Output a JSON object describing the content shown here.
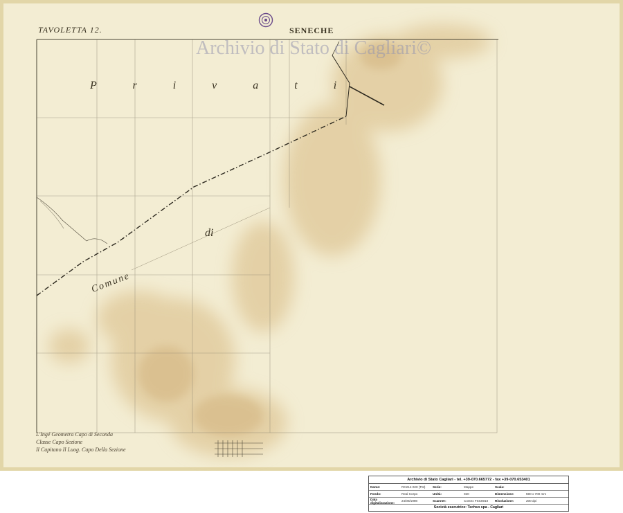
{
  "map": {
    "sheet_label": "TAVOLETTA 12.",
    "locality": "SENECHE",
    "watermark": "Archivio di Stato di Cagliari©",
    "label_privati": "P r i v a t i",
    "label_di": "di",
    "label_comune": "Comune",
    "signature_lines": [
      "L'Ingé Geometra Capo di Seconda",
      "Classe Capo Sezione",
      "Il Capitano Il Luog. Capo Della Sezione"
    ],
    "colors": {
      "paper": "#f2ecd0",
      "stain": "#d9bd85",
      "ink": "#3a3322",
      "watermark": "#9696af"
    }
  },
  "info_table": {
    "title": "Archivio di Stato Cagliari - tel. +39-070.665772 - fax +39-070.653401",
    "rows": [
      [
        {
          "k": "Nome:",
          "v": "RC214-020 (TM)"
        },
        {
          "k": "Serie:",
          "v": "Mappe"
        },
        {
          "k": "Scala:",
          "v": ""
        }
      ],
      [
        {
          "k": "Fondo:",
          "v": "Real Corpo"
        },
        {
          "k": "Unità:",
          "v": "020"
        },
        {
          "k": "Dimensione:",
          "v": "590 x 700 mm"
        }
      ],
      [
        {
          "k": "Data digitalizzazione:",
          "v": "24/09/1998"
        },
        {
          "k": "Scanner:",
          "v": "Contex FSC8010"
        },
        {
          "k": "Risoluzione:",
          "v": "200 dpi"
        }
      ]
    ],
    "footer": "Società esecutrice: Techso spa - Cagliari"
  }
}
